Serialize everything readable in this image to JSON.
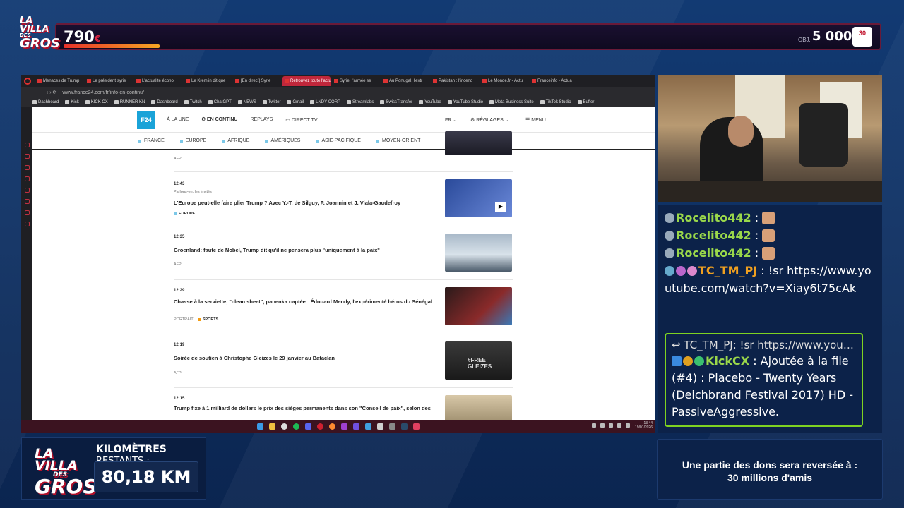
{
  "overlay": {
    "logo_lines": [
      "LA VILLA",
      "DES",
      "GROS"
    ],
    "top_counter": "790",
    "top_counter_unit": "€",
    "goal_label": "OBJ.",
    "goal_value": "5 000",
    "goal_unit": "€",
    "goal_badge": "30",
    "km_label_bold": "KILOMÈTRES",
    "km_label_rest": " RESTANTS :",
    "km_value": "80,18 KM",
    "donation_line1": "Une partie des dons sera reversée à :",
    "donation_line2": "30 millions d'amis"
  },
  "browser": {
    "tabs": [
      {
        "label": "Menaces de Trump",
        "active": false
      },
      {
        "label": "Le président syrie",
        "active": false
      },
      {
        "label": "L'actualité écono",
        "active": false
      },
      {
        "label": "Le Kremlin dit que",
        "active": false
      },
      {
        "label": "[En direct] Syrie",
        "active": false
      },
      {
        "label": "Retrouvez toute l'actualité",
        "active": true
      },
      {
        "label": "Syrie: l'armée se",
        "active": false
      },
      {
        "label": "Au Portugal, l'extr",
        "active": false
      },
      {
        "label": "Pakistan : l'incend",
        "active": false
      },
      {
        "label": "Le Monde.fr - Actu",
        "active": false
      },
      {
        "label": "Franceinfo - Actua",
        "active": false
      }
    ],
    "url": "www.france24.com/fr/info-en-continu/",
    "bookmarks": [
      "Dashboard",
      "Kick",
      "KICK CX",
      "RUNNER KN",
      "Dashboard",
      "Twitch",
      "ChatGPT",
      "NEWS",
      "Twitter",
      "Gmail",
      "LNDY CORP",
      "Streamlabs",
      "SwissTransfer",
      "YouTube",
      "YouTube Studio",
      "Meta Business Suite",
      "TikTok Studio",
      "Buffer"
    ],
    "clock_time": "13:44",
    "clock_date": "19/01/2026"
  },
  "site": {
    "logo": "FRANCE 24",
    "nav": {
      "a_la_une": "À LA UNE",
      "en_continu": "EN CONTINU",
      "replays": "REPLAYS",
      "direct_tv": "DIRECT TV",
      "lang": "FR",
      "reglages": "RÉGLAGES",
      "menu": "MENU"
    },
    "regions": [
      "FRANCE",
      "EUROPE",
      "AFRIQUE",
      "AMÉRIQUES",
      "ASIE-PACIFIQUE",
      "MOYEN-ORIENT"
    ],
    "items": [
      {
        "time": "",
        "kicker": "",
        "headline": "",
        "source": "AFP",
        "tag": ""
      },
      {
        "time": "12:43",
        "kicker": "Parlons-en, les invités",
        "headline": "L'Europe peut-elle faire plier Trump ? Avec Y.-T. de Silguy, P. Joannin et J. Viala-Gaudefroy",
        "source": "",
        "tag": "EUROPE"
      },
      {
        "time": "12:35",
        "kicker": "",
        "headline": "Groenland: faute de Nobel, Trump dit qu'il ne pensera plus \"uniquement à la paix\"",
        "source": "AFP",
        "tag": ""
      },
      {
        "time": "12:29",
        "kicker": "",
        "headline": "Chasse à la serviette, \"clean sheet\", panenka captée : Édouard Mendy, l'expérimenté héros du Sénégal",
        "source": "PORTRAIT",
        "tag": "SPORTS"
      },
      {
        "time": "12:19",
        "kicker": "",
        "headline": "Soirée de soutien à Christophe Gleizes le 29 janvier au Bataclan",
        "source": "AFP",
        "tag": ""
      },
      {
        "time": "12:15",
        "kicker": "",
        "headline": "Trump fixe à 1 milliard de dollars le prix des sièges permanents dans son \"Conseil de paix\", selon des",
        "source": "",
        "tag": ""
      }
    ]
  },
  "chat": {
    "messages": [
      {
        "user": "Rocelito442",
        "sep": ":",
        "text": ""
      },
      {
        "user": "Rocelito442",
        "sep": ":",
        "text": ""
      },
      {
        "user": "Rocelito442",
        "sep": ":",
        "text": ""
      },
      {
        "user": "TC_TM_PJ",
        "sep": ":",
        "text": "!sr https://www.youtube.com/watch?v=Xiay6t75cAk"
      }
    ],
    "reply": {
      "quoted_user": "TC_TM_PJ:",
      "quoted_text": "!sr https://www.yout...",
      "user": "KickCX",
      "sep": ":",
      "text": "Ajoutée à la file (#4) : Placebo - Twenty Years (Deichbrand Festival 2017) HD - PassiveAggressive."
    }
  },
  "colors": {
    "accent_red": "#c0273b",
    "chat_user_green": "#9ad84a",
    "chat_user_orange": "#f0a020",
    "reply_border": "#7ed321"
  }
}
